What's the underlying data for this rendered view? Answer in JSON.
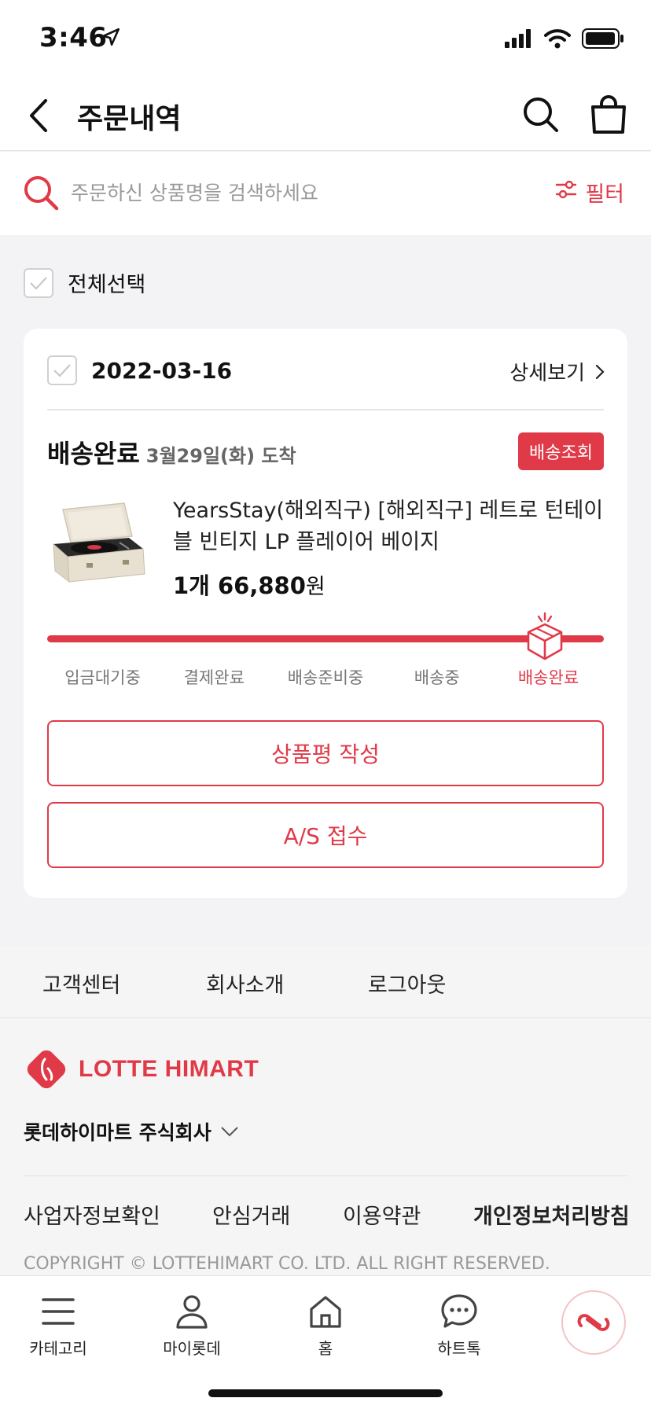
{
  "status_bar": {
    "time": "3:46"
  },
  "header": {
    "title": "주문내역"
  },
  "search": {
    "placeholder": "주문하신 상품명을 검색하세요",
    "filter_label": "필터"
  },
  "select_all_label": "전체선택",
  "order": {
    "date": "2022-03-16",
    "detail_label": "상세보기",
    "delivery_status": "배송완료",
    "arrival": "3월29일(화) 도착",
    "track_label": "배송조회",
    "product_name": "YearsStay(해외직구) [해외직구] 레트로 턴테이블 빈티지 LP 플레이어 베이지",
    "quantity": "1개",
    "price": "66,880",
    "price_unit": "원",
    "steps": [
      "입금대기중",
      "결제완료",
      "배송준비중",
      "배송중",
      "배송완료"
    ],
    "active_step": 4,
    "review_button": "상품평 작성",
    "as_button": "A/S 접수"
  },
  "footer": {
    "links": [
      "고객센터",
      "회사소개",
      "로그아웃"
    ],
    "brand": "LOTTE HIMART",
    "company": "롯데하이마트 주식회사",
    "legal_links": [
      "사업자정보확인",
      "안심거래",
      "이용약관",
      "개인정보처리방침"
    ],
    "copyright": "COPYRIGHT © LOTTEHIMART CO. LTD. ALL RIGHT RESERVED."
  },
  "tabbar": {
    "items": [
      "카테고리",
      "마이롯데",
      "홈",
      "하트톡"
    ]
  },
  "colors": {
    "accent": "#e03a48",
    "text": "#111111",
    "muted": "#999999"
  }
}
